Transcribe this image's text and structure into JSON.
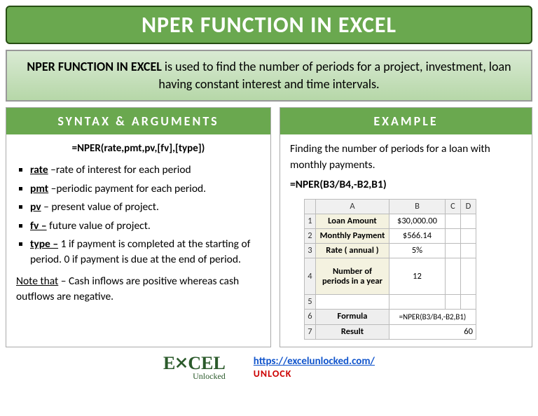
{
  "title": "NPER FUNCTION IN EXCEL",
  "description": {
    "bold": "NPER FUNCTION IN EXCEL",
    "rest": " is used to find the number of periods for a project, investment, loan having constant interest and time intervals."
  },
  "syntax": {
    "heading": "SYNTAX & ARGUMENTS",
    "formula": "=NPER(rate,pmt,pv,[fv],[type])",
    "args": [
      {
        "name": "rate",
        "sep": " –",
        "desc": "rate of interest for each period"
      },
      {
        "name": "pmt",
        "sep": " –",
        "desc": "periodic payment for each period."
      },
      {
        "name": "pv",
        "sep": " – ",
        "desc": "present value of project."
      },
      {
        "name": "fv –",
        "sep": " ",
        "desc": "future value of project."
      },
      {
        "name": "type –",
        "sep": " ",
        "desc": "1 if payment is completed at the starting of period. 0 if payment is due at the end of period."
      }
    ],
    "note_label": "Note that",
    "note_text": " – Cash inflows are positive whereas cash outflows are negative."
  },
  "example": {
    "heading": "EXAMPLE",
    "intro": "Finding the number of periods for a loan with monthly payments.",
    "formula": "=NPER(B3/B4,-B2,B1)",
    "sheet": {
      "cols": [
        "A",
        "B",
        "C",
        "D"
      ],
      "rows": [
        {
          "n": "1",
          "a": "Loan Amount",
          "b": "$30,000.00"
        },
        {
          "n": "2",
          "a": "Monthly Payment",
          "b": "$566.14"
        },
        {
          "n": "3",
          "a": "Rate ( annual )",
          "b": "5%"
        },
        {
          "n": "4",
          "a": "Number of periods in a year",
          "b": "12"
        },
        {
          "n": "5",
          "a": "",
          "b": ""
        },
        {
          "n": "6",
          "a": "Formula",
          "b": "=NPER(B3/B4,-B2,B1)"
        },
        {
          "n": "7",
          "a": "Result",
          "b": "60"
        }
      ]
    }
  },
  "footer": {
    "logo_pre": "E",
    "logo_post": "CEL",
    "logo_sub": "Unlocked",
    "url": "https://excelunlocked.com/",
    "unlock": "UNLOCK"
  }
}
